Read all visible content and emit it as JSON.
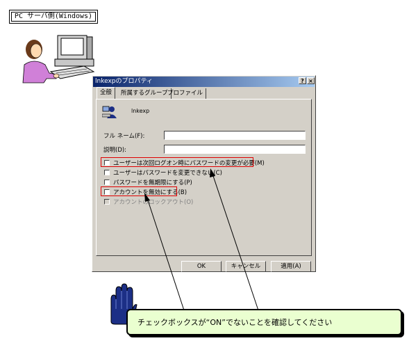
{
  "server_label": "PC サーバ側(Windows)",
  "dialog": {
    "title": "lnkexpのプロパティ",
    "help_btn": "?",
    "close_btn": "×",
    "tabs": [
      "全般",
      "所属するグループ",
      "プロファイル"
    ],
    "user_name": "lnkexp",
    "fullname_label": "フル ネーム(F):",
    "description_label": "説明(D):",
    "checkboxes": [
      "ユーザーは次回ログオン時にパスワードの変更が必要(M)",
      "ユーザーはパスワードを変更できない(C)",
      "パスワードを無期限にする(P)",
      "アカウントを無効にする(B)",
      "アカウントのロックアウト(O)"
    ],
    "ok_button": "OK",
    "cancel_button": "キャンセル",
    "apply_button": "適用(A)"
  },
  "note": "チェックボックスが“ON”でないことを確認してください",
  "colors": {
    "title_start": "#0a246a",
    "title_end": "#a6caf0",
    "dialog_face": "#d4d0c8",
    "highlight": "#e00000",
    "note_bg": "#eaffd0",
    "hand": "#1c2f86"
  },
  "icons": [
    "person-at-computer-icon",
    "user-icon",
    "hand-icon"
  ]
}
